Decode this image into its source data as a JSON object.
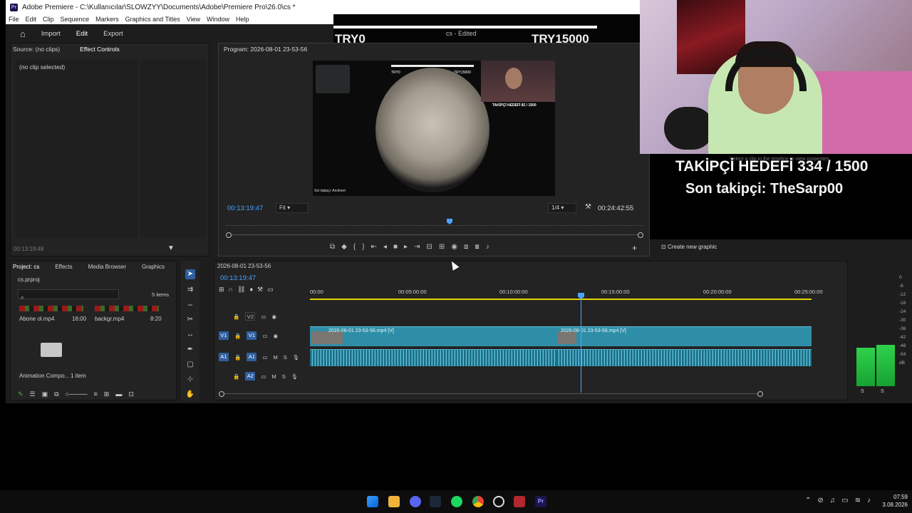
{
  "window": {
    "title": "Adobe Premiere - C:\\Kullanıcılar\\SLOWZYY\\Documents\\Adobe\\Premiere Pro\\26.0\\cs *",
    "app_badge": "Pr"
  },
  "menu": [
    "File",
    "Edit",
    "Clip",
    "Sequence",
    "Markers",
    "Graphics and Titles",
    "View",
    "Window",
    "Help"
  ],
  "workspace": {
    "home": "⌂",
    "tabs": [
      "Import",
      "Edit",
      "Export"
    ],
    "active": "Edit",
    "project_status": "cs - Edited"
  },
  "stream_overlay": {
    "left_amount": "TRY0",
    "right_amount": "TRY15000",
    "goal_line": "TAKİPÇİ HEDEFİ 334 / 1500",
    "last_follower": "Son takipçi: TheSarp00",
    "hint": "Select a clip in the timeline to view properties"
  },
  "source_panel": {
    "tabs": [
      "Source: (no clips)",
      "Effect Controls"
    ],
    "no_clip": "(no clip selected)",
    "timecode": "00:13:19:48"
  },
  "program_panel": {
    "title": "Program: 2026-08-01 23-53-56",
    "timecode": "00:13:19:47",
    "fit": "Fit",
    "resolution": "1/4",
    "duration": "00:24:42:55",
    "preview": {
      "left_amount": "TRY0",
      "right_amount": "TRY15000",
      "goal": "TAKİPÇİ HEDEFİ 82 / 1500",
      "killfeed": "Sol takipçi: Anılmert"
    }
  },
  "essential_graphics": {
    "create_label": "Create new graphic"
  },
  "project_panel": {
    "tabs": [
      "Project: cs",
      "Effects",
      "Media Browser",
      "Graphics"
    ],
    "file": "cs.prproj",
    "item_count": "5 items",
    "clips": [
      {
        "name": "Abone ol.mp4",
        "duration": "16:00"
      },
      {
        "name": "backgr.mp4",
        "duration": "8:20"
      }
    ],
    "bin": {
      "name": "Animation Compo...",
      "count": "1 item"
    }
  },
  "timeline": {
    "sequence": "2026-08-01 23-53-56",
    "timecode": "00:13:19:47",
    "ruler": [
      "00:00",
      "00:05:00:00",
      "00:10:00:00",
      "00:15:00:00",
      "00:20:00:00",
      "00:25:00:00"
    ],
    "tracks": {
      "v2": "V2",
      "v1_source": "V1",
      "v1": "V1",
      "a1_source": "A1",
      "a1": "A1",
      "a2": "A2",
      "mute": "M",
      "solo": "S"
    },
    "clips": [
      {
        "label": "2026-08-01 23-53-56.mp4 [V]"
      },
      {
        "label": "2026-08-01 23-53-56.mp4 [V]"
      }
    ]
  },
  "meters": {
    "scale": [
      "0",
      "-6",
      "-12",
      "-18",
      "-24",
      "-30",
      "-36",
      "-42",
      "-48",
      "-54",
      "dB"
    ],
    "channels": [
      "S",
      "S"
    ]
  },
  "taskbar": {
    "time": "07:59",
    "date": "3.08.2026"
  }
}
